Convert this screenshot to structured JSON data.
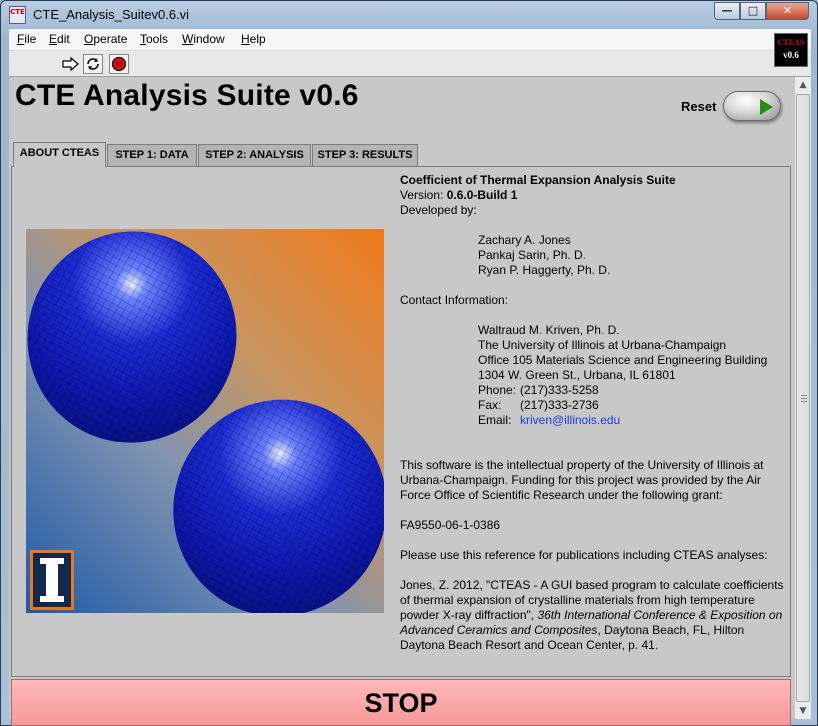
{
  "window": {
    "title": "CTE_Analysis_Suitev0.6.vi",
    "icon_text": "CTE",
    "controls": {
      "minimize": "0",
      "maximize": "1",
      "close": "r"
    }
  },
  "menubar": {
    "items": [
      {
        "label": "File",
        "accel": "F"
      },
      {
        "label": "Edit",
        "accel": "E"
      },
      {
        "label": "Operate",
        "accel": "O"
      },
      {
        "label": "Tools",
        "accel": "T"
      },
      {
        "label": "Window",
        "accel": "W"
      },
      {
        "label": "Help",
        "accel": "H"
      }
    ]
  },
  "toolbar": {
    "buttons": [
      "run-arrow-icon",
      "run-continuously-icon",
      "abort-icon"
    ],
    "vi_icon": {
      "line1": "CTEAS",
      "line2": "v0.6"
    }
  },
  "panel": {
    "title": "CTE Analysis Suite v0.6",
    "reset_label": "Reset",
    "stop_label": "STOP",
    "tabs": [
      {
        "label": "ABOUT CTEAS",
        "active": true
      },
      {
        "label": "STEP 1: DATA",
        "active": false
      },
      {
        "label": "STEP 2: ANALYSIS",
        "active": false
      },
      {
        "label": "STEP 3: RESULTS",
        "active": false
      }
    ]
  },
  "about": {
    "heading": "Coefficient of Thermal Expansion Analysis Suite",
    "version_label": "Version: ",
    "version_value": "0.6.0-Build 1",
    "developed_by": "Developed by:",
    "developers": [
      "Zachary A. Jones",
      "Pankaj Sarin, Ph. D.",
      "Ryan P. Haggerty, Ph. D."
    ],
    "contact_heading": "Contact Information:",
    "contact_lines": [
      "Waltraud M. Kriven, Ph. D.",
      "The University of Illinois at Urbana-Champaign",
      "Office 105 Materials Science and Engineering Building",
      "1304 W. Green St., Urbana, IL 61801"
    ],
    "phone_label": "Phone:",
    "phone": "(217)333-5258",
    "fax_label": "Fax:",
    "fax": "(217)333-2736",
    "email_label": "Email:",
    "email": "kriven@illinois.edu",
    "ip_text": "This software is the intellectual property of the University of Illinois at Urbana-Champaign.  Funding for this project was provided by the Air Force Office of Scientific Research under the following grant:",
    "grant": "FA9550-06-1-0386",
    "reference_intro": "Please use this reference for publications including CTEAS analyses:",
    "citation_a": "Jones, Z. 2012, \"CTEAS - A GUI based program to calculate coefficients of thermal expansion of crystalline materials from high temperature powder X-ray diffraction\", ",
    "citation_b": "36th International Conference & Exposition on Advanced Ceramics and Composites",
    "citation_c": ", Daytona Beach, FL, Hilton Daytona Beach Resort and Ocean Center, p. 41."
  },
  "colors": {
    "stop_bg": "#f7a5a5",
    "panel_bg": "#c8c8c8",
    "link": "#1a3ad8",
    "logo_orange": "#e87722",
    "logo_blue": "#13294b"
  }
}
